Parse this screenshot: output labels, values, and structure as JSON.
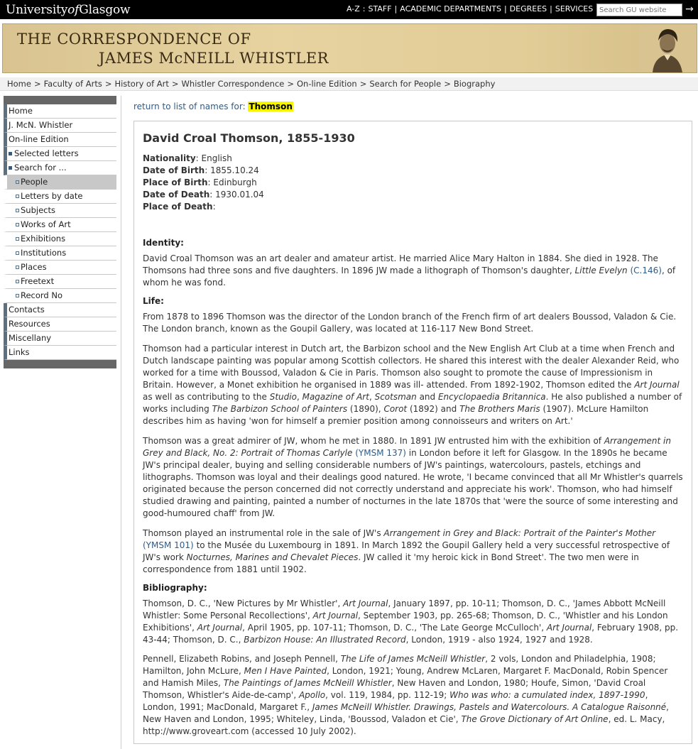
{
  "topbar": {
    "logo_pre": "University",
    "logo_of": "of",
    "logo_post": "Glasgow",
    "links": [
      "A-Z",
      "STAFF",
      "ACADEMIC DEPARTMENTS",
      "DEGREES",
      "SERVICES"
    ],
    "search_placeholder": "Search GU website",
    "search_go": "→"
  },
  "banner": {
    "line1": "THE CORRESPONDENCE OF",
    "line2": "JAMES McNEILL WHISTLER"
  },
  "breadcrumb": [
    "Home",
    "Faculty of Arts",
    "History of Art",
    "Whistler Correspondence",
    "On-line Edition",
    "Search for People",
    "Biography"
  ],
  "sidebar": {
    "items": [
      {
        "label": "Home",
        "level": 0
      },
      {
        "label": "J. McN. Whistler",
        "level": 0
      },
      {
        "label": "On-line Edition",
        "level": 0
      },
      {
        "label": "Selected letters",
        "level": 1
      },
      {
        "label": "Search for ...",
        "level": 1
      },
      {
        "label": "People",
        "level": 2,
        "active": true
      },
      {
        "label": "Letters by date",
        "level": 2
      },
      {
        "label": "Subjects",
        "level": 2
      },
      {
        "label": "Works of Art",
        "level": 2
      },
      {
        "label": "Exhibitions",
        "level": 2
      },
      {
        "label": "Institutions",
        "level": 2
      },
      {
        "label": "Places",
        "level": 2
      },
      {
        "label": "Freetext",
        "level": 2
      },
      {
        "label": "Record No",
        "level": 2
      },
      {
        "label": "Contacts",
        "level": 0
      },
      {
        "label": "Resources",
        "level": 0
      },
      {
        "label": "Miscellany",
        "level": 0
      },
      {
        "label": "Links",
        "level": 0
      }
    ]
  },
  "return_link": {
    "text": "return to list of names for:",
    "name": "Thomson"
  },
  "bio": {
    "title": "David Croal Thomson, 1855-1930",
    "facts": [
      {
        "label": "Nationality",
        "value": "English"
      },
      {
        "label": "Date of Birth",
        "value": "1855.10.24"
      },
      {
        "label": "Place of Birth",
        "value": "Edinburgh"
      },
      {
        "label": "Date of Death",
        "value": "1930.01.04"
      },
      {
        "label": "Place of Death",
        "value": ""
      }
    ],
    "identity_head": "Identity:",
    "identity": [
      {
        "t": "David Croal Thomson was an art dealer and amateur artist. He married Alice Mary Halton in 1884. She died in 1928. The Thomsons had three sons and five daughters. In 1896 JW made a lithograph of Thomson's daughter, "
      },
      {
        "i": "Little Evelyn"
      },
      {
        "t": " "
      },
      {
        "r": "(C.146)"
      },
      {
        "t": ", of whom he was fond."
      }
    ],
    "life_head": "Life:",
    "life": [
      [
        {
          "t": "From 1878 to 1896 Thomson was the director of the London branch of the French firm of art dealers Boussod, Valadon & Cie. The London branch, known as the Goupil Gallery, was located at 116-117 New Bond Street."
        }
      ],
      [
        {
          "t": "Thomson had a particular interest in Dutch art, the Barbizon school and the New English Art Club at a time when French and Dutch landscape painting was popular among Scottish collectors. He shared this interest with the dealer Alexander Reid, who worked for a time with Boussod, Valadon & Cie in Paris. Thomson also sought to promote the cause of Impressionism in Britain. However, a Monet exhibition he organised in 1889 was ill- attended. From 1892-1902, Thomson edited the "
        },
        {
          "i": "Art Journal"
        },
        {
          "t": " as well as contributing to the "
        },
        {
          "i": "Studio"
        },
        {
          "t": ", "
        },
        {
          "i": "Magazine of Art"
        },
        {
          "t": ", "
        },
        {
          "i": "Scotsman"
        },
        {
          "t": " and "
        },
        {
          "i": "Encyclopaedia Britannica"
        },
        {
          "t": ". He also published a number of works including "
        },
        {
          "i": "The Barbizon School of Painters"
        },
        {
          "t": " (1890), "
        },
        {
          "i": "Corot"
        },
        {
          "t": " (1892) and "
        },
        {
          "i": "The Brothers Maris"
        },
        {
          "t": " (1907). McLure Hamilton describes him as having 'won for himself a premier position among connoisseurs and writers on Art.'"
        }
      ],
      [
        {
          "t": "Thomson was a great admirer of JW, whom he met in 1880. In 1891 JW entrusted him with the exhibition of "
        },
        {
          "i": "Arrangement in Grey and Black, No. 2: Portrait of Thomas Carlyle"
        },
        {
          "t": " "
        },
        {
          "r": "(YMSM 137)"
        },
        {
          "t": " in London before it left for Glasgow. In the 1890s he became JW's principal dealer, buying and selling considerable numbers of JW's paintings, watercolours, pastels, etchings and lithographs. Thomson was loyal and their dealings good natured. He wrote, 'I became convinced that all Mr Whistler's quarrels originated because the person concerned did not correctly understand and appreciate his work'. Thomson, who had himself studied drawing and painting, painted a number of nocturnes in the late 1870s that 'were the source of some interesting and good-humoured chaff' from JW."
        }
      ],
      [
        {
          "t": "Thomson played an instrumental role in the sale of JW's "
        },
        {
          "i": "Arrangement in Grey and Black: Portrait of the Painter's Mother"
        },
        {
          "t": " "
        },
        {
          "r": "(YMSM 101)"
        },
        {
          "t": " to the Musée du Luxembourg in 1891. In March 1892 the Goupil Gallery held a very successful retrospective of JW's work "
        },
        {
          "i": "Nocturnes, Marines and Chevalet Pieces"
        },
        {
          "t": ". JW called it 'my heroic kick in Bond Street'. The two men were in correspondence from 1881 until 1902."
        }
      ]
    ],
    "bibliography_head": "Bibliography:",
    "bibliography": [
      [
        {
          "t": "Thomson, D. C., 'New Pictures by Mr Whistler', "
        },
        {
          "i": "Art Journal"
        },
        {
          "t": ", January 1897, pp. 10-11; Thomson, D. C., 'James Abbott McNeill Whistler: Some Personal Recollections', "
        },
        {
          "i": "Art Journal"
        },
        {
          "t": ", September 1903, pp. 265-68; Thomson, D. C., 'Whistler and his London Exhibitions', "
        },
        {
          "i": "Art Journal"
        },
        {
          "t": ", April 1905, pp. 107-11; Thomson, D. C., 'The Late George McCulloch', "
        },
        {
          "i": "Art Journal"
        },
        {
          "t": ", February 1908, pp. 43-44; Thomson, D. C., "
        },
        {
          "i": "Barbizon House: An Illustrated Record"
        },
        {
          "t": ", London, 1919 - also 1924, 1927 and 1928."
        }
      ],
      [
        {
          "t": "Pennell, Elizabeth Robins, and Joseph Pennell, "
        },
        {
          "i": "The Life of James McNeill Whistler"
        },
        {
          "t": ", 2 vols, London and Philadelphia, 1908; Hamilton, John McLure, "
        },
        {
          "i": "Men I Have Painted"
        },
        {
          "t": ", London, 1921; Young, Andrew McLaren, Margaret F. MacDonald, Robin Spencer and Hamish Miles, "
        },
        {
          "i": "The Paintings of James McNeill Whistler"
        },
        {
          "t": ", New Haven and London, 1980; Houfe, Simon, 'David Croal Thomson, Whistler's Aide-de-camp', "
        },
        {
          "i": "Apollo"
        },
        {
          "t": ", vol. 119, 1984, pp. 112-19; "
        },
        {
          "i": "Who was who: a cumulated index, 1897-1990"
        },
        {
          "t": ", London, 1991; MacDonald, Margaret F., "
        },
        {
          "i": "James McNeill Whistler. Drawings, Pastels and Watercolours. A Catalogue Raisonné"
        },
        {
          "t": ", New Haven and London, 1995; Whiteley, Linda, 'Boussod, Valadon et Cie', "
        },
        {
          "i": "The Grove Dictionary of Art Online"
        },
        {
          "t": ", ed. L. Macy, http://www.groveart.com (accessed 10 July 2002)."
        }
      ]
    ]
  }
}
